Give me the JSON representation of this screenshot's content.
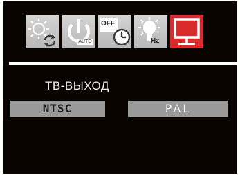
{
  "menu": {
    "icons": [
      {
        "name": "brightness-auto-icon"
      },
      {
        "name": "power-auto-icon",
        "caption": "AUTO"
      },
      {
        "name": "off-timer-icon",
        "caption": "OFF"
      },
      {
        "name": "hz-lamp-icon",
        "caption": "Hz"
      },
      {
        "name": "tv-output-icon",
        "active": true
      }
    ],
    "active_color": "#d92b2b"
  },
  "section": {
    "title": "ТВ-ВЫХОД"
  },
  "options": [
    {
      "label": "NTSC"
    },
    {
      "label": "PAL"
    }
  ]
}
